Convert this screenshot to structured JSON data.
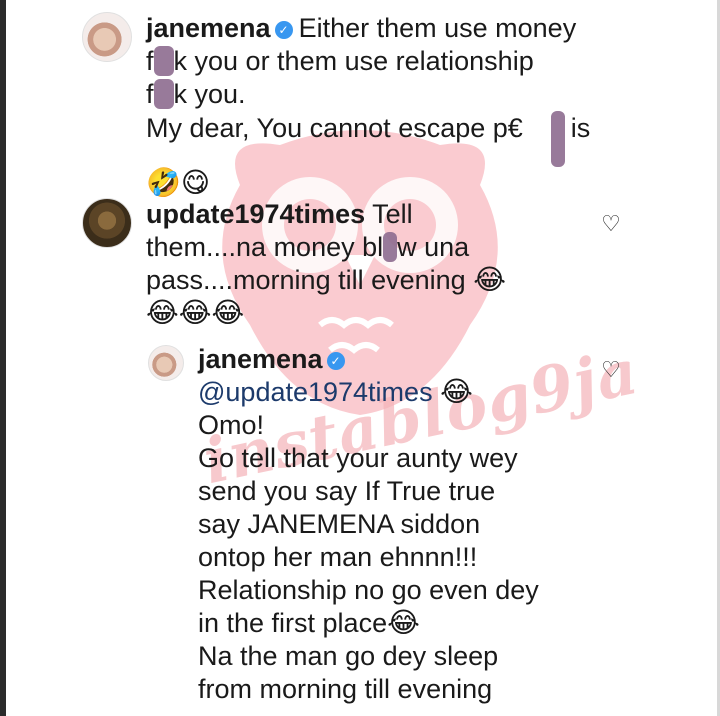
{
  "watermark": {
    "text": "instablog9ja"
  },
  "comments": [
    {
      "username": "janemena",
      "verified": true,
      "lines": [
        "Either them use money",
        "k you or them use relationship",
        "k you.",
        "My dear, You cannot escape p€",
        "is"
      ],
      "letter_f": "f",
      "emojis": [
        "🤣",
        "😋"
      ]
    },
    {
      "username": "update1974times",
      "verified": false,
      "lines": [
        "Tell",
        "them....na money bl",
        "w una",
        "pass....morning till evening"
      ],
      "emojis": [
        "😂",
        "😂",
        "😂",
        "😂"
      ]
    },
    {
      "username": "janemena",
      "verified": true,
      "mention": "@update1974times",
      "lines": [
        "Omo!",
        "Go tell that your aunty wey",
        "send you say If True true",
        "say JANEMENA siddon",
        "ontop her man ehnnn!!!",
        "Relationship no go even dey",
        "in the first place",
        "Na the man go dey sleep",
        "from morning till evening"
      ],
      "emojis": [
        "😂",
        "😂"
      ]
    }
  ],
  "icons": {
    "heart": "heart-outline-icon",
    "verified": "verified-badge-icon"
  }
}
